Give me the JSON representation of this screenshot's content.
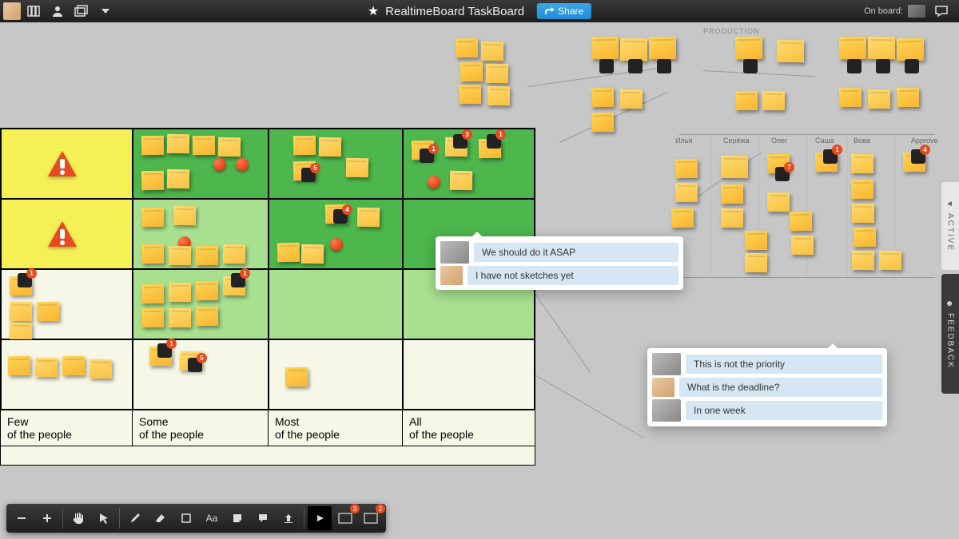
{
  "header": {
    "title": "RealtimeBoard TaskBoard",
    "share_label": "Share",
    "onboard_label": "On board:"
  },
  "matrix": {
    "x_axis": [
      {
        "label_top": "Few",
        "label_bot": "of the people"
      },
      {
        "label_top": "Some",
        "label_bot": "of the people"
      },
      {
        "label_top": "Most",
        "label_bot": "of the people"
      },
      {
        "label_top": "All",
        "label_bot": "of the people"
      }
    ]
  },
  "assignees": {
    "names": [
      "Илья",
      "Серёжа",
      "Олег",
      "Саша",
      "Вова"
    ],
    "approve_label": "Approve"
  },
  "popups": {
    "p1": [
      {
        "text": "We should do it ASAP",
        "avatar": "m"
      },
      {
        "text": "I have not sketches yet",
        "avatar": "p"
      }
    ],
    "p2": [
      {
        "text": "This is not the priority",
        "avatar": "m"
      },
      {
        "text": "What is the deadline?",
        "avatar": "p"
      },
      {
        "text": "In one week",
        "avatar": "m"
      }
    ]
  },
  "badges": {
    "b1": "1",
    "b2": "2",
    "b3": "3",
    "b4": "4",
    "b5": "5",
    "b7": "7"
  },
  "rails": {
    "active": "ACTIVE",
    "feedback": "FEEDBACK"
  },
  "stage_labels": [
    "PRODUCTION"
  ]
}
